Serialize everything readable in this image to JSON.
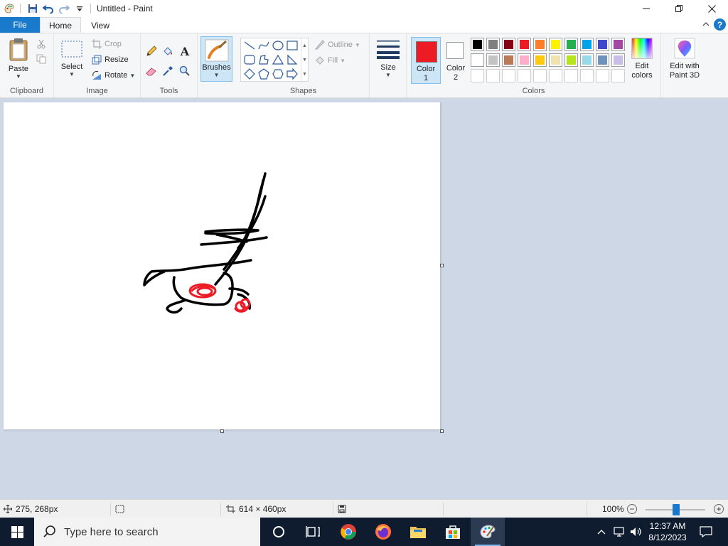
{
  "window": {
    "title": "Untitled - Paint"
  },
  "tabs": {
    "file": "File",
    "home": "Home",
    "view": "View"
  },
  "ribbon": {
    "clipboard": {
      "label": "Clipboard",
      "paste": "Paste"
    },
    "image": {
      "label": "Image",
      "select": "Select",
      "crop": "Crop",
      "resize": "Resize",
      "rotate": "Rotate"
    },
    "tools": {
      "label": "Tools"
    },
    "brushes": {
      "label": "Brushes"
    },
    "shapes": {
      "label": "Shapes",
      "outline": "Outline",
      "fill": "Fill"
    },
    "size": {
      "label": "Size"
    },
    "colors": {
      "label": "Colors",
      "color1_label": "Color\n1",
      "color2_label": "Color\n2",
      "color1": "#ed1c24",
      "color2": "#ffffff",
      "edit_colors": "Edit\ncolors",
      "palette_row1": [
        "#000000",
        "#7f7f7f",
        "#880015",
        "#ed1c24",
        "#ff7f27",
        "#fff200",
        "#22b14c",
        "#00a2e8",
        "#3f48cc",
        "#a349a4"
      ],
      "palette_row2": [
        "#ffffff",
        "#c3c3c3",
        "#b97a57",
        "#ffaec9",
        "#ffc90e",
        "#efe4b0",
        "#b5e61d",
        "#99d9ea",
        "#7092be",
        "#c8bfe7"
      ]
    },
    "paint3d": {
      "label": "Edit with\nPaint 3D"
    }
  },
  "statusbar": {
    "cursor_pos": "275, 268px",
    "canvas_size": "614 × 460px",
    "zoom": "100%"
  },
  "taskbar": {
    "search_placeholder": "Type here to search",
    "time": "12:37 AM",
    "date": "8/12/2023"
  }
}
